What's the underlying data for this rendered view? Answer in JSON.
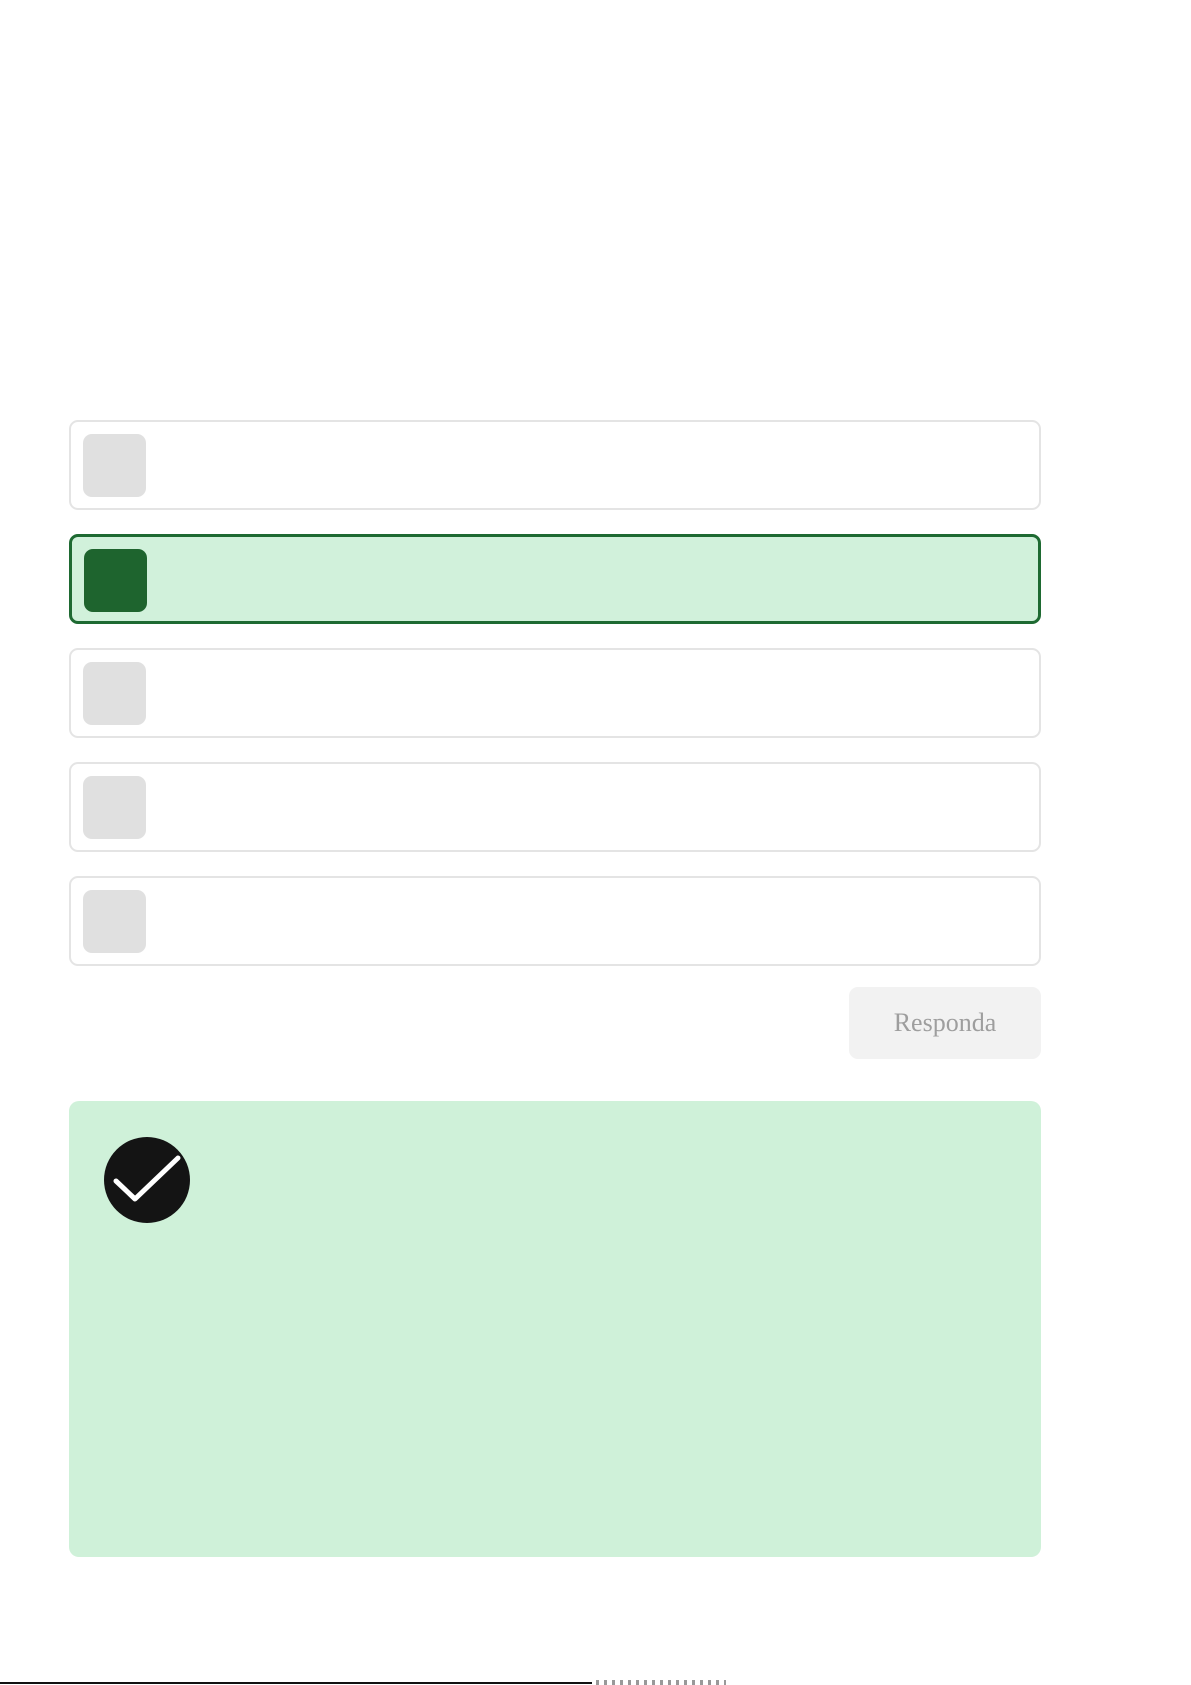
{
  "options": [
    {
      "label": "",
      "selected": false
    },
    {
      "label": "",
      "selected": true
    },
    {
      "label": "",
      "selected": false
    },
    {
      "label": "",
      "selected": false
    },
    {
      "label": "",
      "selected": false
    }
  ],
  "answer_button": {
    "label": "Responda"
  },
  "feedback": {
    "status": "correct",
    "icon": "check-circle-icon",
    "text": ""
  },
  "colors": {
    "selected_border": "#1e6a32",
    "selected_background": "#d1f1db",
    "selected_marker": "#1e642e",
    "feedback_background": "#cff1d9",
    "button_background": "#f2f2f2",
    "button_text": "#9e9e9e"
  }
}
